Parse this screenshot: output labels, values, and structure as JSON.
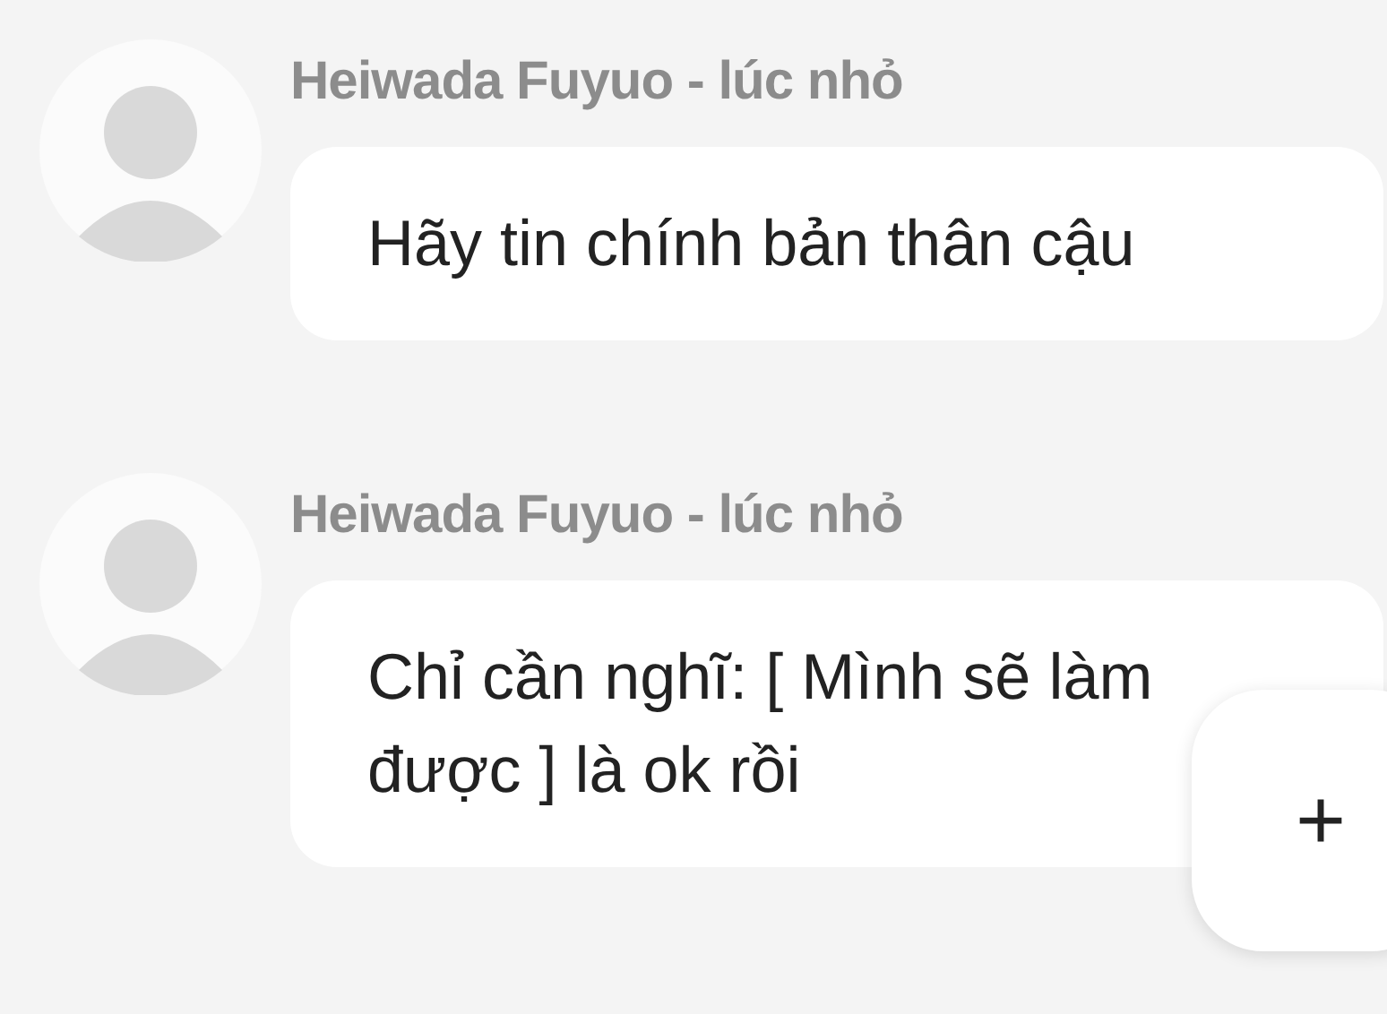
{
  "messages": [
    {
      "sender": "Heiwada Fuyuo - lúc nhỏ",
      "text": "Hãy tin chính bản thân cậu"
    },
    {
      "sender": "Heiwada Fuyuo - lúc nhỏ",
      "text": "Chỉ cần nghĩ: [ Mình sẽ làm được ] là ok rồi"
    }
  ],
  "add_button": {
    "label": "+"
  }
}
